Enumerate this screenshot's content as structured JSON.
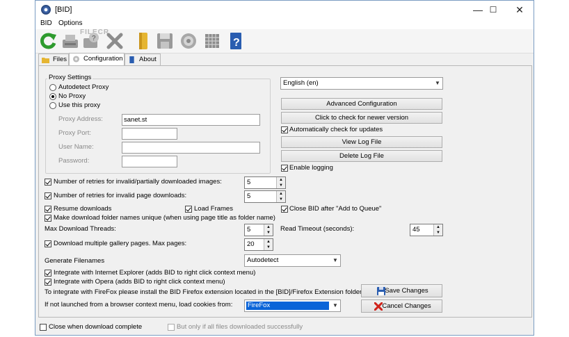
{
  "window": {
    "title": "[BID]",
    "minimize": "—",
    "maximize": "☐",
    "close": "✕"
  },
  "menu": [
    "BID",
    "Options"
  ],
  "watermark": "FILECR",
  "toolbar_icons": [
    "refresh-icon",
    "download-icon",
    "help-icon",
    "stop-icon",
    "folder-icon",
    "save-icon",
    "settings-icon",
    "grid-icon",
    "info-icon"
  ],
  "tabs": [
    {
      "label": "Files",
      "icon": "folder-icon"
    },
    {
      "label": "Configuration",
      "icon": "gear-icon"
    },
    {
      "label": "About",
      "icon": "info-icon"
    }
  ],
  "proxy": {
    "group_label": "Proxy Settings",
    "options": [
      {
        "label": "Autodetect Proxy",
        "selected": false
      },
      {
        "label": "No Proxy",
        "selected": true
      },
      {
        "label": "Use this proxy",
        "selected": false
      }
    ],
    "address_label": "Proxy Address:",
    "address_value": "sanet.st",
    "port_label": "Proxy Port:",
    "port_value": "",
    "user_label": "User Name:",
    "user_value": "",
    "password_label": "Password:",
    "password_value": ""
  },
  "language": {
    "value": "English (en)"
  },
  "buttons": {
    "advanced": "Advanced Configuration",
    "check_version": "Click to check for newer version",
    "view_log": "View Log File",
    "delete_log": "Delete Log File",
    "save": "Save Changes",
    "cancel": "Cancel Changes"
  },
  "auto_check": {
    "label": "Automatically check for updates",
    "checked": true
  },
  "enable_logging": {
    "label": "Enable logging",
    "checked": true
  },
  "retries_images": {
    "label": "Number of retries for invalid/partially downloaded images:",
    "checked": true,
    "value": "5"
  },
  "retries_pages": {
    "label": "Number of retries for invalid page downloads:",
    "checked": true,
    "value": "5"
  },
  "resume": {
    "label": "Resume downloads",
    "checked": true
  },
  "load_frames": {
    "label": "Load Frames",
    "checked": true
  },
  "close_bid": {
    "label": "Close BID after \"Add to Queue\"",
    "checked": true
  },
  "unique_names": {
    "label": "Make download folder names unique (when using page title as folder name)",
    "checked": true
  },
  "threads": {
    "label": "Max Download Threads:",
    "value": "5"
  },
  "read_timeout": {
    "label": "Read Timeout (seconds):",
    "value": "45"
  },
  "multi_pages": {
    "label": "Download multiple gallery pages. Max pages:",
    "checked": true,
    "value": "20"
  },
  "gen_filenames": {
    "label": "Generate Filenames",
    "value": "Autodetect"
  },
  "ie": {
    "label": "Integrate with Internet Explorer (adds BID to right click context menu)",
    "checked": true
  },
  "opera": {
    "label": "Integrate with Opera (adds BID to right click context menu)",
    "checked": true
  },
  "firefox_note": "To integrate with FireFox please install the BID Firefox extension located in the [BID]/Firefox Extension folder.",
  "cookies": {
    "label": "If not launched from a browser context menu, load cookies from:",
    "value": "FireFox"
  },
  "status": {
    "close_when_done": {
      "label": "Close when download complete",
      "checked": false
    },
    "only_if_success": {
      "label": "But only if all files downloaded successfully",
      "checked": false
    }
  },
  "colors": {
    "accent": "#0a64d8",
    "save_icon": "#2a5db0",
    "cancel_icon": "#d0231b",
    "refresh": "#2e9b2e"
  }
}
